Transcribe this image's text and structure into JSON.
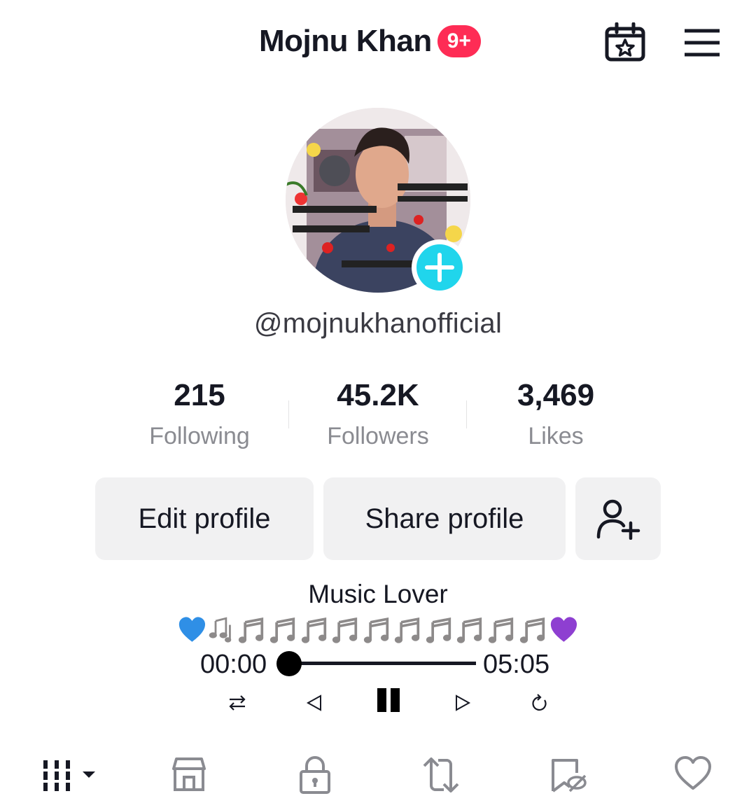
{
  "header": {
    "title": "Mojnu Khan",
    "badge": "9+",
    "icons": [
      "calendar-star-icon",
      "hamburger-menu-icon"
    ]
  },
  "profile": {
    "username": "@mojnukhanofficial"
  },
  "stats": [
    {
      "value": "215",
      "label": "Following"
    },
    {
      "value": "45.2K",
      "label": "Followers"
    },
    {
      "value": "3,469",
      "label": "Likes"
    }
  ],
  "actions": {
    "edit": "Edit profile",
    "share": "Share profile"
  },
  "bio": {
    "title": "Music Lover",
    "emoji": [
      "blue-heart",
      "notes",
      "note",
      "note",
      "note",
      "note",
      "note",
      "note",
      "note",
      "note",
      "note",
      "purple-heart"
    ]
  },
  "player": {
    "current_time": "00:00",
    "duration": "05:05",
    "progress": 0
  },
  "tabs": [
    "videos-grid",
    "shop",
    "private",
    "reposts",
    "favorites",
    "liked"
  ],
  "colors": {
    "accent": "#fe2c55",
    "add_button": "#20d5ec",
    "button_bg": "#f1f1f2",
    "blue_heart": "#2f8fe6",
    "purple_heart": "#8e3fd1"
  }
}
